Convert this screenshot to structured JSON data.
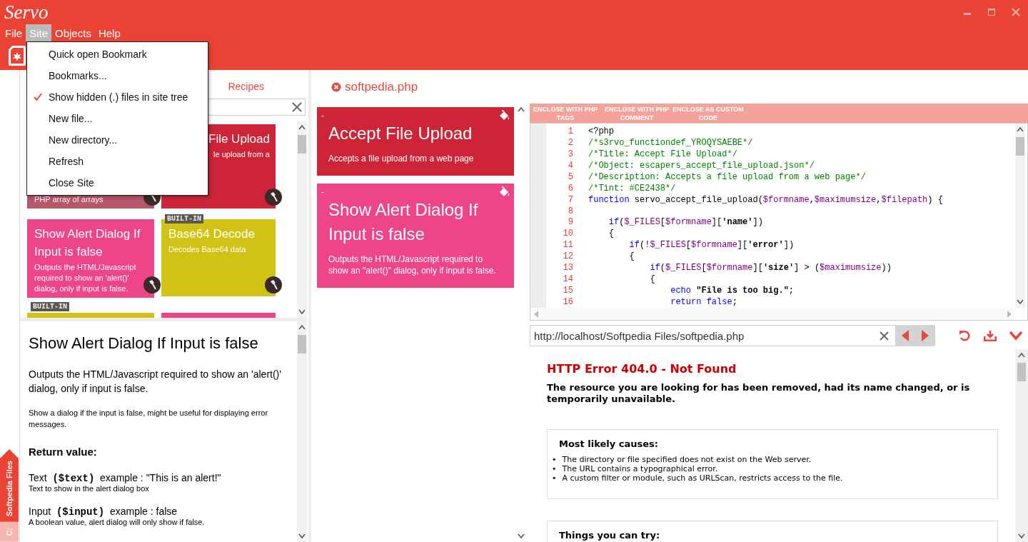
{
  "title_bar": {
    "logo": "Servo"
  },
  "menu_bar": [
    {
      "label": "File",
      "selected": false
    },
    {
      "label": "Site",
      "selected": true
    },
    {
      "label": "Objects",
      "selected": false
    },
    {
      "label": "Help",
      "selected": false
    }
  ],
  "site_menu": [
    {
      "label": "Quick open Bookmark",
      "checked": false
    },
    {
      "label": "Bookmarks...",
      "checked": false
    },
    {
      "label": "Show hidden (.) files in site tree",
      "checked": true
    },
    {
      "label": "New file...",
      "checked": false
    },
    {
      "label": "New directory...",
      "checked": false
    },
    {
      "label": "Refresh",
      "checked": false
    },
    {
      "label": "Close Site",
      "checked": false
    }
  ],
  "side_tabs": [
    {
      "label": "Softpedia Files",
      "selected": true
    },
    {
      "label": "C:",
      "selected": false
    }
  ],
  "recipes": {
    "tab": "Recipes",
    "cards": [
      {
        "kind": "tail",
        "description": "PHP array of arrays",
        "color": "#b8566b"
      },
      {
        "kind": "clipped",
        "title": "File Upload",
        "description": "le upload from a",
        "color": "#ce2438"
      },
      {
        "kind": "full",
        "title": "Show Alert Dialog If Input is false",
        "description": "Outputs the HTML/Javascript required to show an 'alert()' dialog, only if input is false.",
        "color": "#ee4488"
      },
      {
        "kind": "full",
        "title": "Base64 Decode",
        "description": "Decodes Base64 data",
        "color": "#d0c315",
        "badge": "BUILT-IN"
      },
      {
        "kind": "stub",
        "color": "#d0c315",
        "badge": "BUILT-IN"
      },
      {
        "kind": "stub",
        "color": "#ee4488"
      }
    ]
  },
  "details": {
    "title": "Show Alert Dialog If Input is false",
    "summary": "Outputs the HTML/Javascript required to show an 'alert()' dialog, only if input is false.",
    "note": "Show a dialog if the input is false, might be useful for displaying error messages.",
    "return_heading": "Return value:",
    "params": [
      {
        "name": "Text",
        "variable": "($text)",
        "example": "example : \"This is an alert!\"",
        "description": "Text to show in the alert dialog box"
      },
      {
        "name": "Input",
        "variable": "($input)",
        "example": "example : false",
        "description": "A boolean value, alert dialog will only show if false."
      }
    ]
  },
  "editor_tab": {
    "label": "softpedia.php"
  },
  "objects": [
    {
      "toggle": "-",
      "title": "Accept File Upload",
      "description": "Accepts a file upload from a web page",
      "color": "#ce2438"
    },
    {
      "toggle": "-",
      "title": "Show Alert Dialog If Input is false",
      "description": "Outputs the HTML/Javascript required to show an \"alert()\" dialog, only if input is false.",
      "color": "#ee4488"
    }
  ],
  "enclose_buttons": [
    "ENCLOSE WITH PHP TAGS",
    "ENCLOSE WITH PHP COMMENT",
    "ENCLOSE AS CUSTOM CODE"
  ],
  "code": [
    {
      "number": "1",
      "segments": [
        {
          "kind": "plain",
          "text": "<?php"
        }
      ]
    },
    {
      "number": "2",
      "segments": [
        {
          "kind": "comment",
          "text": "/*s3rvo_functiondef_YROQYSAEBE*/"
        }
      ]
    },
    {
      "number": "3",
      "segments": [
        {
          "kind": "comment",
          "text": "/*Title: Accept File Upload*/"
        }
      ]
    },
    {
      "number": "4",
      "segments": [
        {
          "kind": "comment",
          "text": "/*Object: escapers_accept_file_upload.json*/"
        }
      ]
    },
    {
      "number": "5",
      "segments": [
        {
          "kind": "comment",
          "text": "/*Description: Accepts a file upload from a web page*/"
        }
      ]
    },
    {
      "number": "6",
      "segments": [
        {
          "kind": "comment",
          "text": "/*Tint: #CE2438*/"
        }
      ]
    },
    {
      "number": "7",
      "segments": [
        {
          "kind": "keyword",
          "text": "function"
        },
        {
          "kind": "plain",
          "text": " servo_accept_file_upload("
        },
        {
          "kind": "variable",
          "text": "$formname"
        },
        {
          "kind": "plain",
          "text": ","
        },
        {
          "kind": "variable",
          "text": "$maximumsize"
        },
        {
          "kind": "plain",
          "text": ","
        },
        {
          "kind": "variable",
          "text": "$filepath"
        },
        {
          "kind": "plain",
          "text": ") {"
        }
      ]
    },
    {
      "number": "8"
    },
    {
      "number": "9",
      "segments": [
        {
          "kind": "keyword",
          "text": "    if"
        },
        {
          "kind": "plain",
          "text": "("
        },
        {
          "kind": "variable",
          "text": "$_FILES"
        },
        {
          "kind": "plain",
          "text": "["
        },
        {
          "kind": "variable",
          "text": "$formname"
        },
        {
          "kind": "plain",
          "text": "]["
        },
        {
          "kind": "string",
          "text": "'name'"
        },
        {
          "kind": "plain",
          "text": "])"
        }
      ]
    },
    {
      "number": "10",
      "segments": [
        {
          "kind": "plain",
          "text": "    {"
        }
      ]
    },
    {
      "number": "11",
      "segments": [
        {
          "kind": "keyword",
          "text": "        if"
        },
        {
          "kind": "plain",
          "text": "(!"
        },
        {
          "kind": "variable",
          "text": "$_FILES"
        },
        {
          "kind": "plain",
          "text": "["
        },
        {
          "kind": "variable",
          "text": "$formname"
        },
        {
          "kind": "plain",
          "text": "]["
        },
        {
          "kind": "string",
          "text": "'error'"
        },
        {
          "kind": "plain",
          "text": "])"
        }
      ]
    },
    {
      "number": "12",
      "segments": [
        {
          "kind": "plain",
          "text": "        {"
        }
      ]
    },
    {
      "number": "13",
      "segments": [
        {
          "kind": "keyword",
          "text": "            if"
        },
        {
          "kind": "plain",
          "text": "("
        },
        {
          "kind": "variable",
          "text": "$_FILES"
        },
        {
          "kind": "plain",
          "text": "["
        },
        {
          "kind": "variable",
          "text": "$formname"
        },
        {
          "kind": "plain",
          "text": "]["
        },
        {
          "kind": "string",
          "text": "'size'"
        },
        {
          "kind": "plain",
          "text": "] > ("
        },
        {
          "kind": "variable",
          "text": "$maximumsize"
        },
        {
          "kind": "plain",
          "text": "))"
        }
      ]
    },
    {
      "number": "14",
      "segments": [
        {
          "kind": "plain",
          "text": "            {"
        }
      ]
    },
    {
      "number": "15",
      "segments": [
        {
          "kind": "keyword",
          "text": "                echo"
        },
        {
          "kind": "string",
          "text": " \"File is too big.\""
        },
        {
          "kind": "plain",
          "text": ";"
        }
      ]
    },
    {
      "number": "16",
      "segments": [
        {
          "kind": "keyword",
          "text": "                return false"
        },
        {
          "kind": "plain",
          "text": ";"
        }
      ]
    }
  ],
  "browser": {
    "url": "http://localhost/Softpedia Files/softpedia.php",
    "heading": "HTTP Error 404.0 - Not Found",
    "message": "The resource you are looking for has been removed, had its name changed, or is temporarily unavailable.",
    "sections": [
      {
        "heading": "Most likely causes:",
        "marker": "•",
        "items": [
          "The directory or file specified does not exist on the Web server.",
          "The URL contains a typographical error.",
          "A custom filter or module, such as URLScan, restricts access to the file."
        ]
      },
      {
        "heading": "Things you can try:"
      }
    ]
  }
}
